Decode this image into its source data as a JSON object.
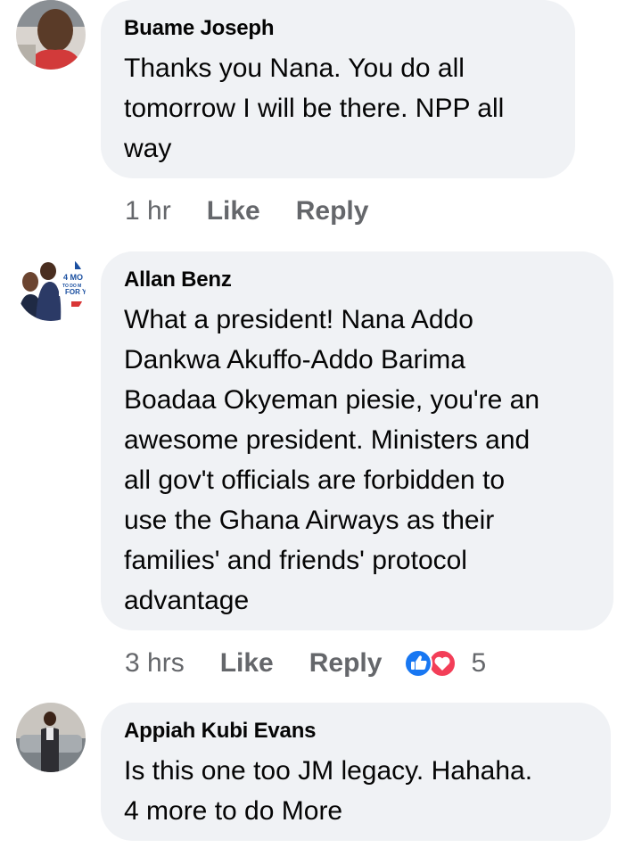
{
  "comments": [
    {
      "author": "Buame Joseph",
      "text": "Thanks you Nana. You do all\ntomorrow I will be there. NPP all\nway",
      "time": "1 hr",
      "like_label": "Like",
      "reply_label": "Reply"
    },
    {
      "author": "Allan Benz",
      "text": "What a president! Nana Addo\nDankwa Akuffo-Addo Barima\nBoadaa Okyeman piesie, you're an\nawesome president. Ministers and\nall gov't officials are forbidden to\nuse the Ghana Airways as their\nfamilies' and friends' protocol\nadvantage",
      "time": "3 hrs",
      "like_label": "Like",
      "reply_label": "Reply",
      "reaction_count": "5",
      "reactions": [
        "like-icon",
        "love-icon"
      ],
      "avatar_text": [
        "4 MO",
        "TO DO M",
        "FOR Y"
      ]
    },
    {
      "author": "Appiah Kubi Evans",
      "text": "Is this one too JM legacy. Hahaha.\n4 more to do More"
    }
  ],
  "colors": {
    "bubble": "#f0f2f5",
    "meta": "#65676b",
    "like_blue": "#1877f2",
    "love_red": "#f33e58"
  }
}
